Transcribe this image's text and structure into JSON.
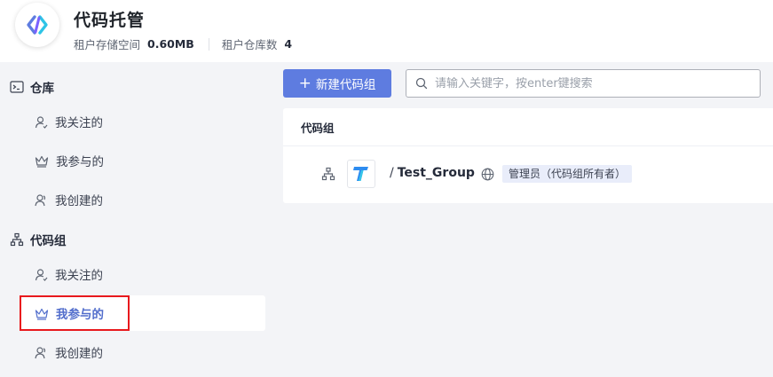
{
  "header": {
    "title": "代码托管",
    "logo_icon": "codearts-logo-icon",
    "storage_label": "租户存储空间",
    "storage_value": "0.60MB",
    "repo_count_label": "租户仓库数",
    "repo_count_value": "4"
  },
  "sidebar": {
    "repos": {
      "title": "仓库",
      "icon": "terminal-icon",
      "items": [
        {
          "label": "我关注的",
          "icon": "person-follow-icon"
        },
        {
          "label": "我参与的",
          "icon": "crown-icon"
        },
        {
          "label": "我创建的",
          "icon": "person-create-icon"
        }
      ]
    },
    "groups": {
      "title": "代码组",
      "icon": "tree-icon",
      "items": [
        {
          "label": "我关注的",
          "icon": "person-follow-icon"
        },
        {
          "label": "我参与的",
          "icon": "crown-icon",
          "active": true
        },
        {
          "label": "我创建的",
          "icon": "person-create-icon"
        }
      ]
    }
  },
  "toolbar": {
    "new_group_label": "新建代码组",
    "search_placeholder": "请输入关键字，按enter键搜索"
  },
  "card": {
    "header": "代码组",
    "group": {
      "separator": "/",
      "name": "Test_Group",
      "visibility_icon": "globe-icon",
      "role": "管理员（代码组所有者）"
    }
  },
  "colors": {
    "primary": "#5e7ce0",
    "active_text": "#526ecc",
    "highlight": "#e8191d",
    "background": "#f3f4f7",
    "badge_bg": "#e9edfa"
  }
}
